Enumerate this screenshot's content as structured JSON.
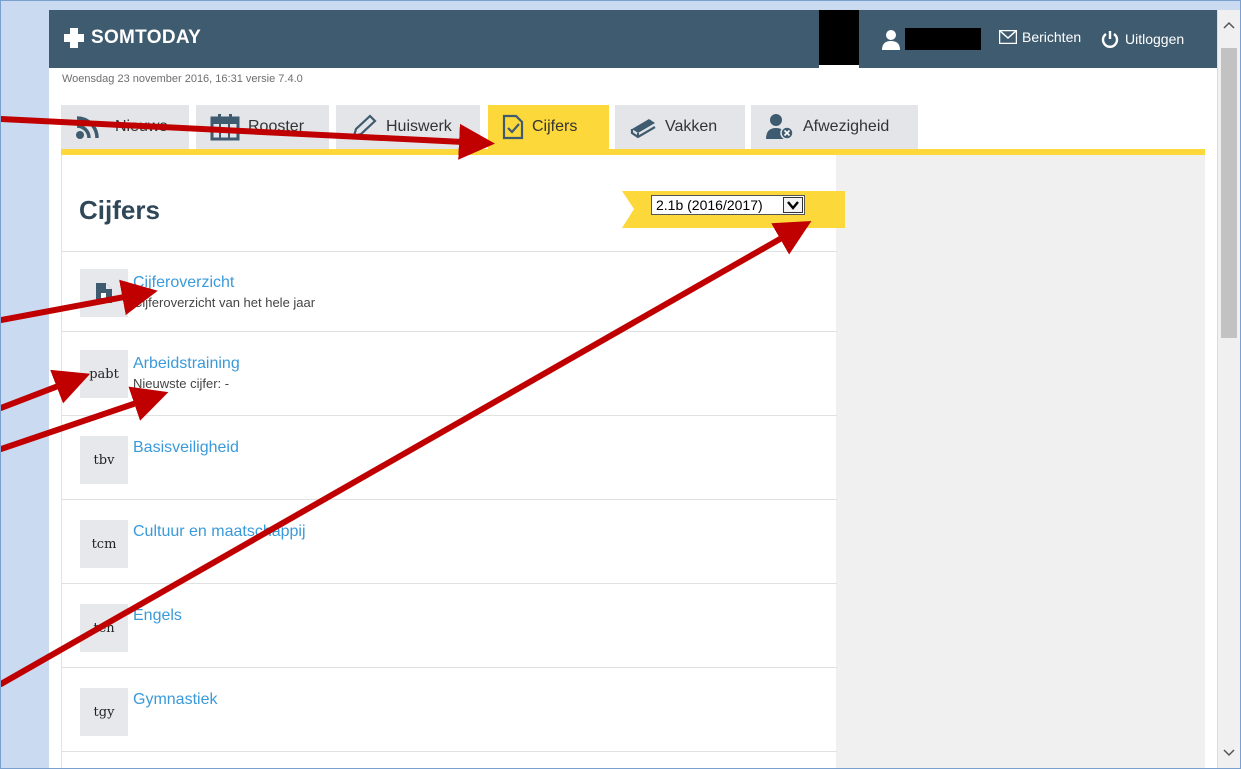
{
  "app": {
    "name": "SOMTODAY",
    "date_line": "Woensdag 23 november 2016, 16:31 versie 7.4.0",
    "berichten": "Berichten",
    "uitloggen": "Uitloggen"
  },
  "tabs": [
    {
      "label": "Nieuws",
      "icon": "rss-icon"
    },
    {
      "label": "Rooster",
      "icon": "calendar-icon"
    },
    {
      "label": "Huiswerk",
      "icon": "pencil-icon"
    },
    {
      "label": "Cijfers",
      "icon": "check-document-icon",
      "active": true
    },
    {
      "label": "Vakken",
      "icon": "books-icon"
    },
    {
      "label": "Afwezigheid",
      "icon": "absent-person-icon"
    }
  ],
  "main": {
    "title": "Cijfers",
    "period_select": "2.1b (2016/2017)"
  },
  "list": [
    {
      "code": "",
      "icon": "document-icon",
      "title": "Cijferoverzicht",
      "subtitle": "Cijferoverzicht van het hele jaar"
    },
    {
      "code": "pabt",
      "title": "Arbeidstraining",
      "subtitle": "Nieuwste cijfer: -"
    },
    {
      "code": "tbv",
      "title": "Basisveiligheid",
      "subtitle": ""
    },
    {
      "code": "tcm",
      "title": "Cultuur en maatschappij",
      "subtitle": ""
    },
    {
      "code": "ten",
      "title": "Engels",
      "subtitle": ""
    },
    {
      "code": "tgy",
      "title": "Gymnastiek",
      "subtitle": ""
    }
  ],
  "colors": {
    "header_bg": "#3f5b6f",
    "accent_yellow": "#fcd83a",
    "link_blue": "#3a9ad9",
    "annotation_red": "#c00000"
  }
}
